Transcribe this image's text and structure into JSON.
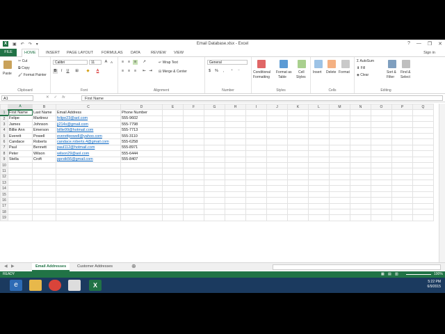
{
  "window": {
    "title": "Email Database.xlsx - Excel",
    "controls": [
      "?",
      "—",
      "❐",
      "✕"
    ]
  },
  "qat": [
    "↶",
    "↷",
    "▾"
  ],
  "ribbon_tabs": [
    "FILE",
    "HOME",
    "INSERT",
    "PAGE LAYOUT",
    "FORMULAS",
    "DATA",
    "REVIEW",
    "VIEW"
  ],
  "signin": "Sign in",
  "ribbon": {
    "clipboard": {
      "paste": "Paste",
      "cut": "Cut",
      "copy": "Copy",
      "format_painter": "Format Painter",
      "label": "Clipboard"
    },
    "font": {
      "name": "Calibri",
      "size": "11",
      "label": "Font"
    },
    "alignment": {
      "wrap": "Wrap Text",
      "merge": "Merge & Center",
      "label": "Alignment"
    },
    "number": {
      "format": "General",
      "label": "Number"
    },
    "styles": {
      "conditional": "Conditional",
      "conditional2": "Formatting",
      "format_table": "Format as",
      "format_table2": "Table",
      "cell_styles": "Cell",
      "cell_styles2": "Styles",
      "label": "Styles"
    },
    "cells": {
      "insert": "Insert",
      "delete": "Delete",
      "format": "Format",
      "label": "Cells"
    },
    "editing": {
      "autosum": "AutoSum",
      "fill": "Fill",
      "clear": "Clear",
      "sort": "Sort &",
      "sort2": "Filter",
      "find": "Find &",
      "find2": "Select",
      "label": "Editing"
    }
  },
  "formula_bar": {
    "namebox": "A1",
    "fx": "fx",
    "cancel": "✕",
    "enter": "✓",
    "value": "First Name"
  },
  "columns": [
    "A",
    "B",
    "C",
    "D",
    "E",
    "F",
    "G",
    "H",
    "I",
    "J",
    "K",
    "L",
    "M",
    "N",
    "O",
    "P",
    "Q"
  ],
  "rows": [
    [
      "First Name",
      "Last Name",
      "Email Address",
      "Phone Number"
    ],
    [
      "Felipe",
      "Martinez",
      "felipe23@aol.com",
      "555-9602"
    ],
    [
      "James",
      "Johnson",
      "jj214x@gmail.com",
      "555-7798"
    ],
    [
      "Billie Ann",
      "Emerson",
      "billie99@hotmail.com",
      "555-7713"
    ],
    [
      "Everett",
      "Powell",
      "everettpowell@yahoo.com",
      "555-3110"
    ],
    [
      "Candace",
      "Roberts",
      "candace.roberts.4@gmail.com",
      "555-6258"
    ],
    [
      "Paul",
      "Bennett",
      "paul112@hotmail.com",
      "555-8971"
    ],
    [
      "Peter",
      "Wilson",
      "wilson29@aol.com",
      "555-6444"
    ],
    [
      "Stella",
      "Croft",
      "pprstk56@gmail.com",
      "555-8407"
    ]
  ],
  "row_count": 19,
  "sheets": [
    "Email Addresses",
    "Customer Addresses"
  ],
  "add_sheet": "⊕",
  "status": {
    "mode": "READY",
    "zoom": "100%"
  },
  "taskbar": {
    "time": "5:22 PM",
    "date": "6/9/2015"
  },
  "colors": {
    "excel_green": "#217346",
    "link": "#0563c1",
    "taskbar": "#1b3a5f"
  }
}
